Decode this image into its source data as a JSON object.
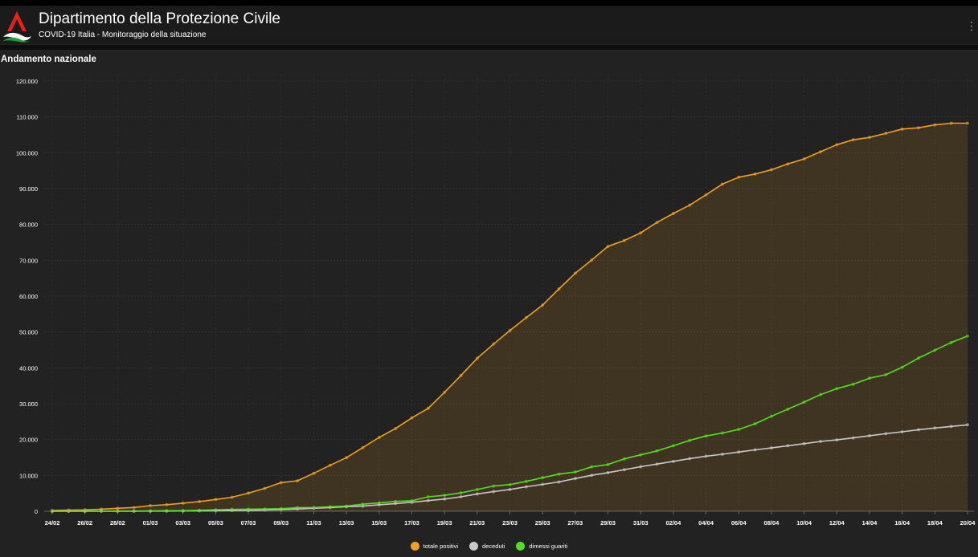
{
  "header": {
    "title": "Dipartimento della Protezione Civile",
    "subtitle": "COVID-19 Italia - Monitoraggio della situazione",
    "logo_icon": "protezione-civile-logo-icon",
    "menu_icon": "more-vert-icon",
    "menu_glyph": "⋮"
  },
  "section": {
    "title": "Andamento nazionale"
  },
  "colors": {
    "background": "#222222",
    "totale_positivi": "#f0a020",
    "deceduti": "#c8c8c8",
    "dimessi_guariti": "#55e01e"
  },
  "chart_data": {
    "type": "line",
    "title": "",
    "xlabel": "",
    "ylabel": "",
    "ylim": [
      0,
      120000
    ],
    "y_ticks": [
      0,
      10000,
      20000,
      30000,
      40000,
      50000,
      60000,
      70000,
      80000,
      90000,
      100000,
      110000,
      120000
    ],
    "y_tick_labels": [
      "0",
      "10.000",
      "20.000",
      "30.000",
      "40.000",
      "50.000",
      "60.000",
      "70.000",
      "80.000",
      "90.000",
      "100.000",
      "110.000",
      "120.000"
    ],
    "x_tick_labels": [
      "24/02",
      "26/02",
      "28/02",
      "01/03",
      "03/03",
      "05/03",
      "07/03",
      "09/03",
      "11/03",
      "13/03",
      "15/03",
      "17/03",
      "19/03",
      "21/03",
      "23/03",
      "25/03",
      "27/03",
      "29/03",
      "31/03",
      "02/04",
      "04/04",
      "06/04",
      "08/04",
      "10/04",
      "12/04",
      "14/04",
      "16/04",
      "18/04",
      "20/04"
    ],
    "grid": true,
    "legend_placement": "bottom-center",
    "x": [
      "24/02",
      "25/02",
      "26/02",
      "27/02",
      "28/02",
      "29/02",
      "01/03",
      "02/03",
      "03/03",
      "04/03",
      "05/03",
      "06/03",
      "07/03",
      "08/03",
      "09/03",
      "10/03",
      "11/03",
      "12/03",
      "13/03",
      "14/03",
      "15/03",
      "16/03",
      "17/03",
      "18/03",
      "19/03",
      "20/03",
      "21/03",
      "22/03",
      "23/03",
      "24/03",
      "25/03",
      "26/03",
      "27/03",
      "28/03",
      "29/03",
      "30/03",
      "31/03",
      "01/04",
      "02/04",
      "03/04",
      "04/04",
      "05/04",
      "06/04",
      "07/04",
      "08/04",
      "09/04",
      "10/04",
      "11/04",
      "12/04",
      "13/04",
      "14/04",
      "15/04",
      "16/04",
      "17/04",
      "18/04",
      "19/04",
      "20/04"
    ],
    "series": [
      {
        "name": "totale positivi",
        "fill": "area",
        "values": [
          221,
          311,
          385,
          588,
          821,
          1049,
          1577,
          1835,
          2263,
          2706,
          3296,
          3916,
          5061,
          6387,
          7985,
          8514,
          10590,
          12839,
          14955,
          17750,
          20603,
          23073,
          26062,
          28710,
          33190,
          37860,
          42681,
          46638,
          50418,
          54030,
          57521,
          62013,
          66414,
          70065,
          73880,
          75528,
          77635,
          80572,
          83049,
          85388,
          88274,
          91246,
          93187,
          94067,
          95262,
          96877,
          98273,
          100269,
          102253,
          103616,
          104291,
          105418,
          106607,
          106962,
          107771,
          108257,
          108237
        ]
      },
      {
        "name": "deceduti",
        "fill": "none",
        "values": [
          7,
          10,
          12,
          17,
          21,
          29,
          34,
          52,
          79,
          107,
          148,
          197,
          233,
          366,
          463,
          631,
          827,
          1016,
          1266,
          1441,
          1809,
          2158,
          2503,
          2978,
          3405,
          4032,
          4825,
          5476,
          6077,
          6820,
          7503,
          8165,
          9134,
          10023,
          10779,
          11591,
          12428,
          13155,
          13915,
          14681,
          15362,
          15887,
          16523,
          17127,
          17669,
          18279,
          18849,
          19468,
          19899,
          20465,
          21067,
          21645,
          22170,
          22745,
          23227,
          23660,
          24114
        ]
      },
      {
        "name": "dimessi guariti",
        "fill": "none",
        "values": [
          1,
          1,
          3,
          45,
          46,
          46,
          83,
          149,
          160,
          276,
          414,
          523,
          589,
          622,
          724,
          1004,
          1045,
          1258,
          1439,
          1966,
          2335,
          2749,
          2941,
          4025,
          4440,
          5129,
          6072,
          7024,
          7432,
          8326,
          9362,
          10361,
          10950,
          12384,
          13030,
          14620,
          15729,
          16847,
          18278,
          19758,
          20996,
          21815,
          22837,
          24392,
          26491,
          28470,
          30455,
          32534,
          34211,
          35435,
          37130,
          38092,
          40164,
          42727,
          44927,
          47055,
          48877
        ]
      }
    ]
  }
}
